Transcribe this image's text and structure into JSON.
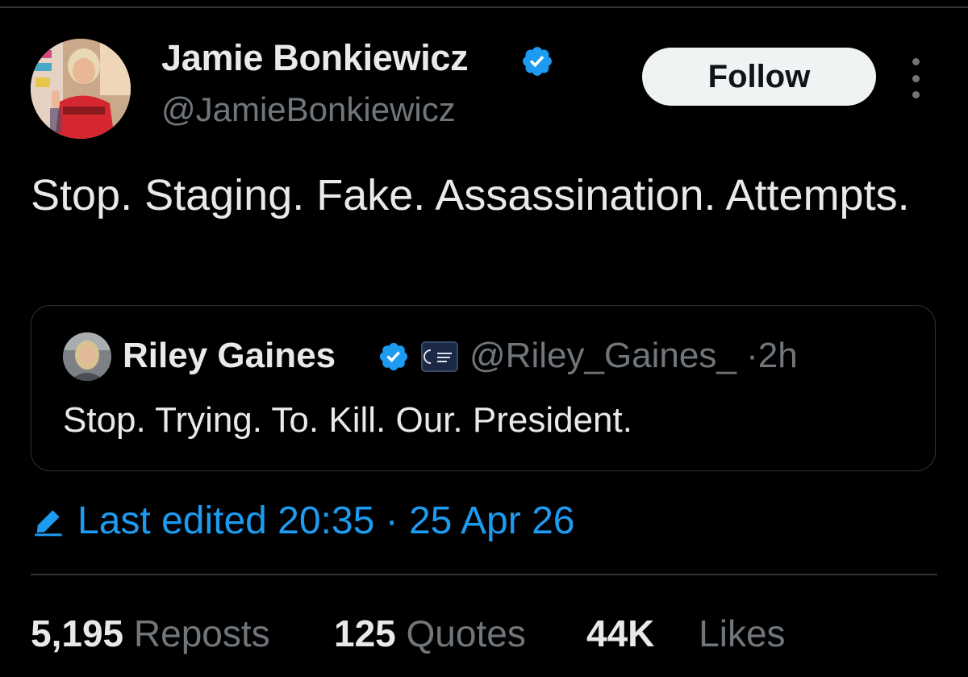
{
  "author": {
    "name": "Jamie Bonkiewicz",
    "handle": "@JamieBonkiewicz",
    "verified": true
  },
  "follow_label": "Follow",
  "tweet_text": "Stop. Staging. Fake. Assassination. Attempts.",
  "quoted_tweet": {
    "name": "Riley Gaines",
    "handle": "@Riley_Gaines_",
    "separator": "·",
    "time": "2h",
    "verified": true,
    "text": "Stop. Trying. To. Kill. Our. President."
  },
  "edited": {
    "label": "Last edited 20:35 · 25 Apr 26"
  },
  "stats": {
    "reposts": {
      "count": "5,195",
      "label": "Reposts"
    },
    "quotes": {
      "count": "125",
      "label": "Quotes"
    },
    "likes": {
      "count": "44K",
      "label": "Likes"
    }
  },
  "icons": {
    "verified": "verified-badge-icon",
    "edit": "pencil-edit-icon",
    "more": "more-dots-icon"
  },
  "colors": {
    "background": "#000000",
    "text_primary": "#e7e9ea",
    "text_secondary": "#71767b",
    "accent_blue": "#1d9bf0",
    "border": "#2f3336",
    "follow_button_bg": "#eff3f4"
  }
}
